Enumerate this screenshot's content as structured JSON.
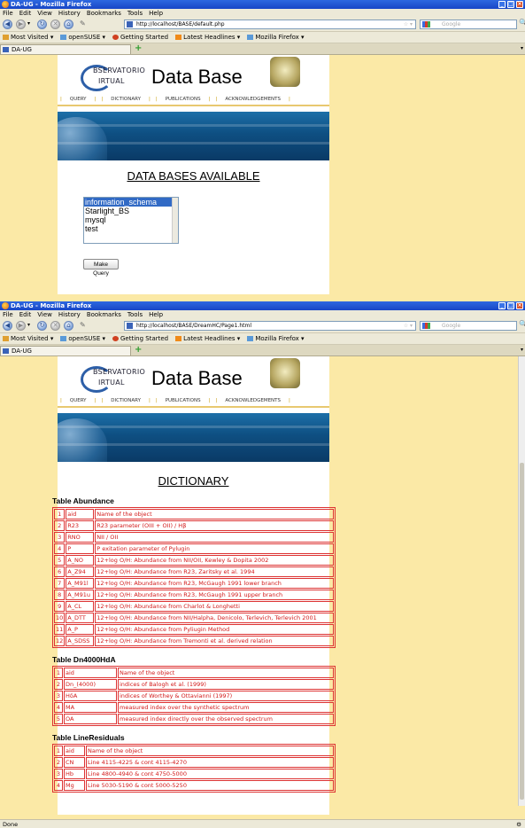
{
  "window1": {
    "title": "DA-UG - Mozilla Firefox",
    "menu": [
      "File",
      "Edit",
      "View",
      "History",
      "Bookmarks",
      "Tools",
      "Help"
    ],
    "url": "http://localhost/BASE/default.php",
    "search_placeholder": "Google",
    "bookmarks": [
      "Most Visited ▾",
      "openSUSE ▾",
      "Getting Started",
      "Latest Headlines ▾",
      "Mozilla Firefox ▾"
    ],
    "tab_label": "DA-UG",
    "page": {
      "logo_line1": "BSERVATORIO",
      "logo_line2": "IRTUAL",
      "site_title": "Data Base",
      "nav": [
        "QUERY",
        "DICTIONARY",
        "PUBLICATIONS",
        "ACKNOWLEDGEMENTS"
      ],
      "heading": "DATA BASES AVAILABLE",
      "databases": [
        "information_schema",
        "Starlight_BS",
        "mysql",
        "test"
      ],
      "selected_database": "information_schema",
      "button": "Make Query"
    }
  },
  "window2": {
    "title": "DA-UG - Mozilla Firefox",
    "menu": [
      "File",
      "Edit",
      "View",
      "History",
      "Bookmarks",
      "Tools",
      "Help"
    ],
    "url": "http://localhost/BASE/DreamHC/Page1.html",
    "search_placeholder": "Google",
    "bookmarks": [
      "Most Visited ▾",
      "openSUSE ▾",
      "Getting Started",
      "Latest Headlines ▾",
      "Mozilla Firefox ▾"
    ],
    "tab_label": "DA-UG",
    "page": {
      "logo_line1": "BSERVATORIO",
      "logo_line2": "IRTUAL",
      "site_title": "Data Base",
      "nav": [
        "QUERY",
        "DICTIONARY",
        "PUBLICATIONS",
        "ACKNOWLEDGEMENTS"
      ],
      "heading": "DICTIONARY",
      "tables": [
        {
          "title": "Table Abundance",
          "rows": [
            [
              "1",
              "aid",
              "Name of the object"
            ],
            [
              "2",
              "R23",
              "R23 parameter (OIII + OII) / Hβ"
            ],
            [
              "3",
              "RNO",
              "NII / OII"
            ],
            [
              "4",
              "P",
              "P exitation parameter of Pylugin"
            ],
            [
              "5",
              "A_NO",
              "12+log O/H: Abundance from NII/OII, Kewley & Dopita 2002"
            ],
            [
              "6",
              "A_Z94",
              "12+log O/H: Abundance from R23, Zaritsky et al. 1994"
            ],
            [
              "7",
              "A_M91l",
              "12+log O/H: Abundance from R23, McGaugh 1991 lower branch"
            ],
            [
              "8",
              "A_M91u",
              "12+log O/H: Abundance from R23, McGaugh 1991 upper branch"
            ],
            [
              "9",
              "A_CL",
              "12+log O/H: Abundance from Charlot & Longhetti"
            ],
            [
              "10",
              "A_DTT",
              "12+log O/H: Abundance from NII/Halpha, Denicolo, Terlevich, Terlevich 2001"
            ],
            [
              "11",
              "A_P",
              "12+log O/H: Abundance from Pyliugin Method"
            ],
            [
              "12",
              "A_SDSS",
              "12+log O/H: Abundance from Tremonti et al. derived relation"
            ]
          ]
        },
        {
          "title": "Table Dn4000HdA",
          "rows": [
            [
              "1",
              "aid",
              "Name of the object"
            ],
            [
              "2",
              "Dn_(4000)",
              "indices of Balogh et al. (1999)"
            ],
            [
              "3",
              "HδA",
              "indices of Worthey & Ottavianni (1997)"
            ],
            [
              "4",
              "MA",
              "measured index over the synthetic spectrum"
            ],
            [
              "5",
              "OA",
              "measured index directly over the observed spectrum"
            ]
          ]
        },
        {
          "title": "Table LineResiduals",
          "rows": [
            [
              "1",
              "aid",
              "Name of the object"
            ],
            [
              "2",
              "CN",
              "Line 4115-4225 & cont 4115-4270"
            ],
            [
              "3",
              "Hb",
              "Line 4800-4940 & cont 4750-5000"
            ],
            [
              "4",
              "Mg",
              "Line 5030-5190 & cont 5000-5250"
            ]
          ]
        }
      ]
    },
    "status": "Done"
  }
}
